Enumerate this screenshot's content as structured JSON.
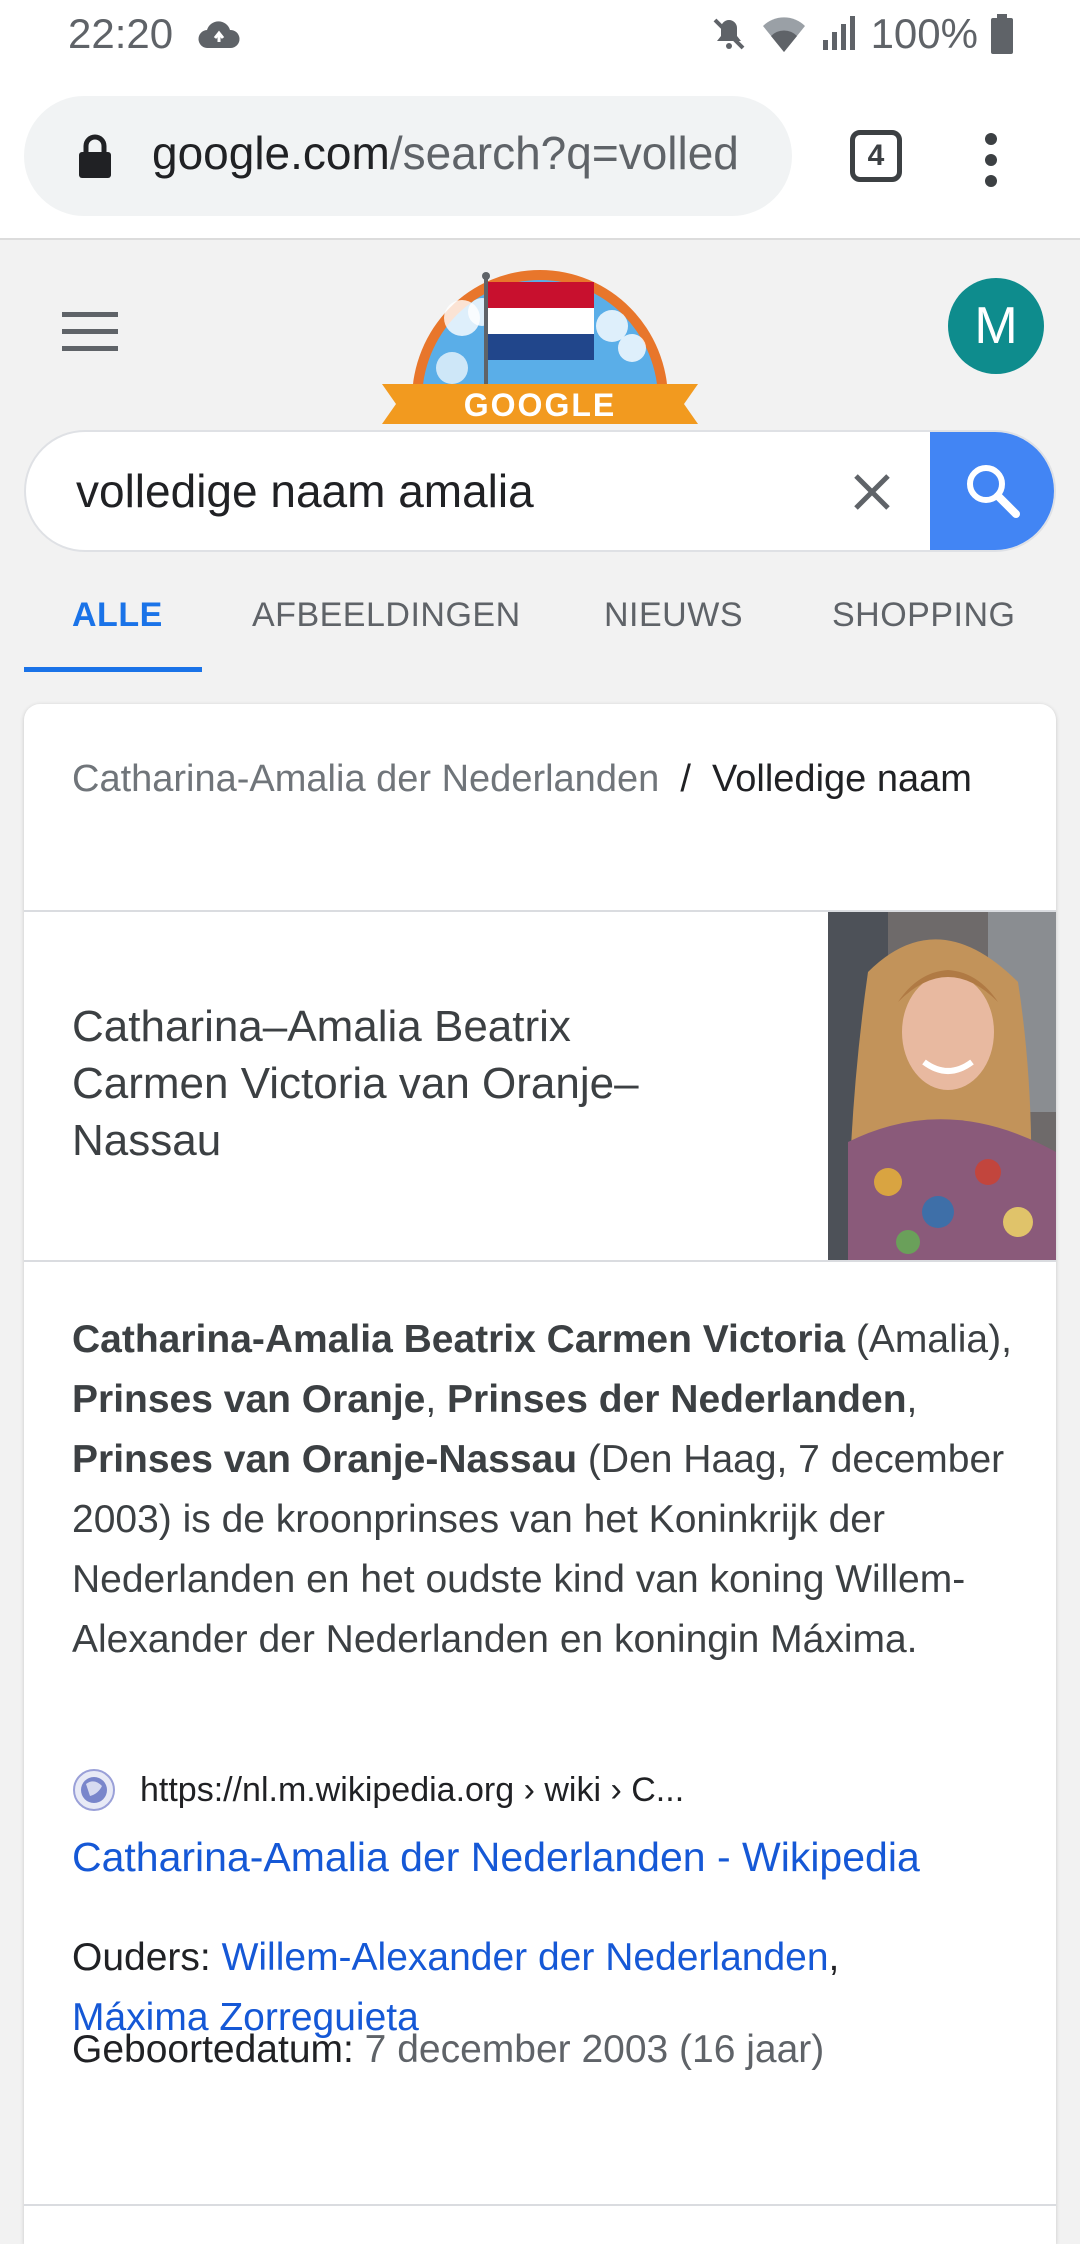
{
  "status_bar": {
    "time": "22:20",
    "battery": "100%"
  },
  "browser": {
    "url_host": "google.com",
    "url_rest": "/search?q=volled",
    "tab_count": "4"
  },
  "header": {
    "doodle_text": "GOOGLE",
    "avatar_letter": "M"
  },
  "search": {
    "query": "volledige naam amalia"
  },
  "tabs": [
    "ALLE",
    "AFBEELDINGEN",
    "NIEUWS",
    "SHOPPING"
  ],
  "result": {
    "breadcrumb_parent": "Catharina-Amalia der Nederlanden",
    "breadcrumb_sep": "/",
    "breadcrumb_current": "Volledige naam",
    "answer": "Catharina–Amalia Beatrix Carmen Victoria van Oranje–Nassau",
    "desc": {
      "b1": "Catharina-Amalia Beatrix Carmen Victoria",
      "t1": " (Amalia), ",
      "b2": "Prinses van Oranje",
      "t2": ", ",
      "b3": "Prinses der Nederlanden",
      "t3": ", ",
      "b4": "Prinses van Oranje-Nassau",
      "t4": " (Den Haag, 7 december 2003) is de kroonprinses van het Koninkrijk der Nederlanden en het oudste kind van koning Willem-Alexander der Nederlanden en koningin Máxima."
    },
    "source_url": "https://nl.m.wikipedia.org › wiki › C...",
    "link_title": "Catharina-Amalia der Nederlanden - Wikipedia",
    "parents_label": "Ouders: ",
    "parent1": "Willem-Alexander der Nederlanden",
    "parent_sep": ",",
    "parent2": "Máxima Zorreguieta",
    "born_label": "Geboortedatum: ",
    "born_value": "7 december 2003 (16 jaar)"
  }
}
